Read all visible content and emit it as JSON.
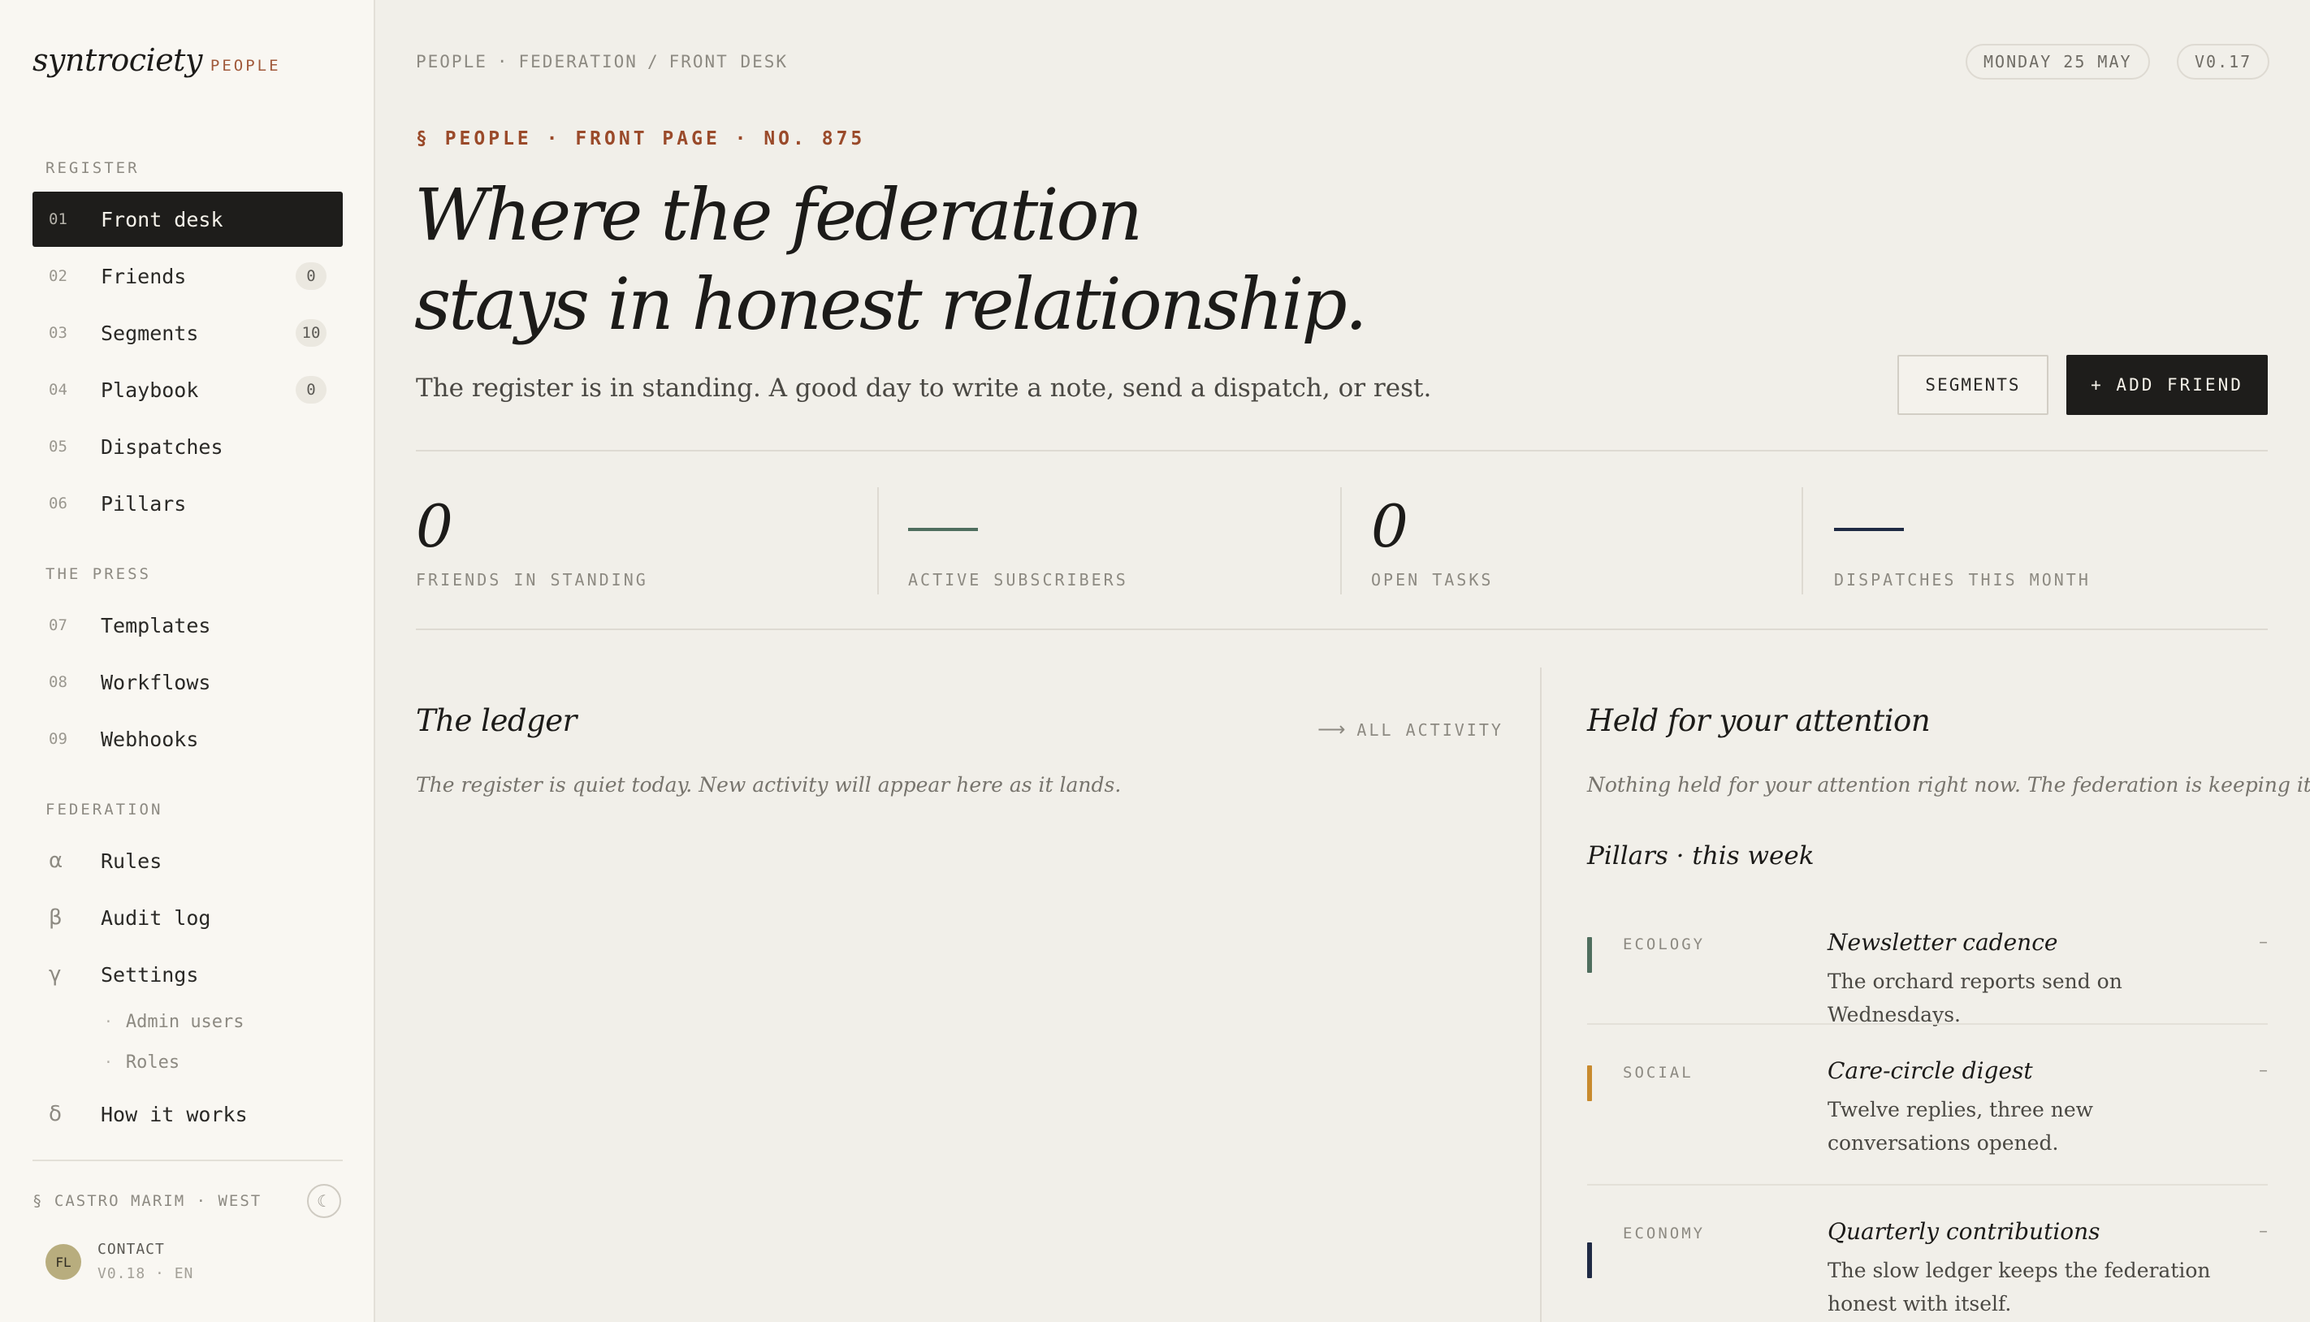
{
  "brand": {
    "name": "syntrociety",
    "tag": "PEOPLE"
  },
  "sidebar": {
    "sections": {
      "register": "REGISTER",
      "press": "THE PRESS",
      "federation": "FEDERATION"
    },
    "register_items": [
      {
        "num": "01",
        "label": "Front desk",
        "active": true
      },
      {
        "num": "02",
        "label": "Friends",
        "badge": "0"
      },
      {
        "num": "03",
        "label": "Segments",
        "badge": "10"
      },
      {
        "num": "04",
        "label": "Playbook",
        "badge": "0"
      },
      {
        "num": "05",
        "label": "Dispatches"
      },
      {
        "num": "06",
        "label": "Pillars"
      }
    ],
    "press_items": [
      {
        "num": "07",
        "label": "Templates"
      },
      {
        "num": "08",
        "label": "Workflows"
      },
      {
        "num": "09",
        "label": "Webhooks"
      }
    ],
    "federation_items": [
      {
        "num": "α",
        "label": "Rules"
      },
      {
        "num": "β",
        "label": "Audit log"
      },
      {
        "num": "γ",
        "label": "Settings"
      },
      {
        "num": "δ",
        "label": "How it works"
      }
    ],
    "settings_sub": [
      "Admin users",
      "Roles"
    ],
    "location": "§ CASTRO MARIM · WEST",
    "theme_icon": "☾",
    "avatar_initials": "FL",
    "contact": "CONTACT",
    "version_sub": "V0.18 · EN"
  },
  "header": {
    "crumbs": [
      "PEOPLE",
      "FEDERATION",
      "FRONT DESK"
    ],
    "crumb_sep_dot": "·",
    "crumb_sep_slash": "/",
    "date": "MONDAY 25 MAY",
    "version": "V0.17"
  },
  "hero": {
    "eyebrow": "§ PEOPLE · FRONT PAGE · NO. 875",
    "line1": "Where the federation",
    "line2": "stays in honest relationship.",
    "standing": "The register is in standing. A good day to write a note, send a dispatch, or rest.",
    "segments_button": "SEGMENTS",
    "add_button": "+ ADD FRIEND"
  },
  "stats": [
    {
      "value": "0",
      "label": "FRIENDS IN STANDING"
    },
    {
      "value": "",
      "label": "ACTIVE SUBSCRIBERS",
      "dash_color": "#4f6e5e"
    },
    {
      "value": "0",
      "label": "OPEN TASKS"
    },
    {
      "value": "",
      "label": "DISPATCHES THIS MONTH",
      "dash_color": "#1f2a44"
    }
  ],
  "ledger": {
    "title": "The ledger",
    "link_arrow": "⟶",
    "link": "ALL ACTIVITY",
    "empty": "The register is quiet today. New activity will appear here as it lands."
  },
  "attention": {
    "title": "Held for your attention",
    "empty": "Nothing held for your attention right now. The federation is keeping itself.",
    "pillars_title": "Pillars · this week",
    "pillars": [
      {
        "category": "ECOLOGY",
        "title": "Newsletter cadence",
        "desc": "The orchard reports send on Wednesdays.",
        "end": "–",
        "color": "#4f6e5e"
      },
      {
        "category": "SOCIAL",
        "title": "Care-circle digest",
        "desc": "Twelve replies, three new conversations opened.",
        "end": "–",
        "color": "#c88a2e"
      },
      {
        "category": "ECONOMY",
        "title": "Quarterly contributions",
        "desc": "The slow ledger keeps the federation honest with itself.",
        "end": "–",
        "color": "#1f2a44"
      }
    ]
  }
}
